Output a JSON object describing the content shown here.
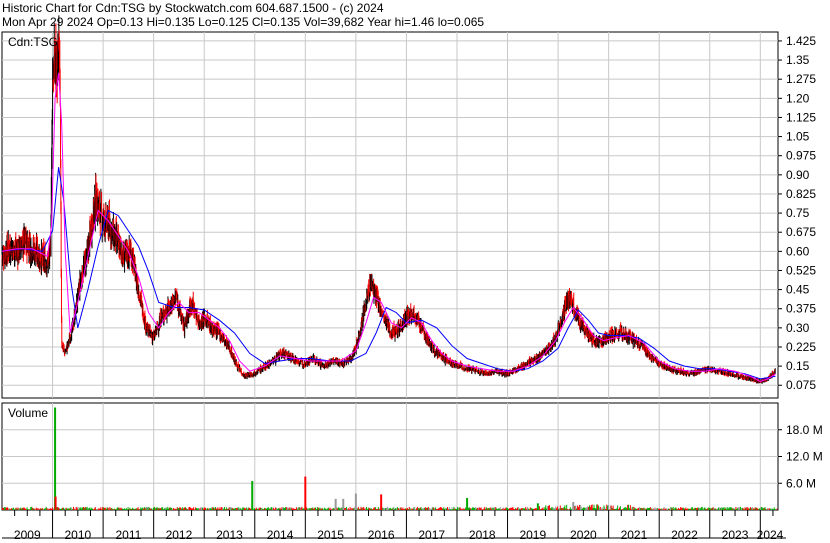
{
  "header": {
    "line1": "Historic Chart for Cdn:TSG by Stockwatch.com 604.687.1500 - (c) 2024",
    "line2": "Mon Apr 29 2024   Op=0.13   Hi=0.135   Lo=0.125   Cl=0.135   Vol=39,682   Year hi=1.46   lo=0.065"
  },
  "colors": {
    "candle_up": "#000000",
    "candle_down": "#ff0000",
    "ma_short": "#ff00ff",
    "ma_long": "#0000ff",
    "vol_up": "#00aa00",
    "vol_down": "#ff0000",
    "vol_neutral": "#999999",
    "grid": "#c8c8c8"
  },
  "chart_data": [
    {
      "type": "line",
      "panel": "price",
      "label": "Cdn:TSG",
      "y_ticks": [
        "1.425",
        "1.35",
        "1.275",
        "1.20",
        "1.125",
        "1.05",
        "0.975",
        "0.90",
        "0.825",
        "0.75",
        "0.675",
        "0.60",
        "0.525",
        "0.45",
        "0.375",
        "0.30",
        "0.225",
        "0.15",
        "0.075"
      ],
      "ylim": [
        0.025,
        1.46
      ],
      "x_labels": [
        "2009",
        "2010",
        "2011",
        "2012",
        "2013",
        "2014",
        "2015",
        "2016",
        "2017",
        "2018",
        "2019",
        "2020",
        "2021",
        "2022",
        "2023",
        "2024"
      ],
      "xlim": [
        2009.0,
        2024.35
      ],
      "grid": true,
      "series": [
        {
          "role": "price",
          "x": [
            2009.0,
            2009.15,
            2009.3,
            2009.45,
            2009.6,
            2009.75,
            2009.9,
            2009.96,
            2010.0,
            2010.05,
            2010.1,
            2010.14,
            2010.18,
            2010.24,
            2010.3,
            2010.4,
            2010.55,
            2010.7,
            2010.85,
            2011.0,
            2011.12,
            2011.25,
            2011.4,
            2011.55,
            2011.7,
            2011.85,
            2012.0,
            2012.15,
            2012.3,
            2012.45,
            2012.6,
            2012.75,
            2012.9,
            2013.0,
            2013.15,
            2013.3,
            2013.5,
            2013.65,
            2013.8,
            2013.95,
            2014.15,
            2014.35,
            2014.55,
            2014.75,
            2014.95,
            2015.15,
            2015.35,
            2015.55,
            2015.75,
            2015.9,
            2016.0,
            2016.1,
            2016.2,
            2016.3,
            2016.4,
            2016.55,
            2016.7,
            2016.85,
            2017.0,
            2017.15,
            2017.3,
            2017.45,
            2017.6,
            2017.75,
            2017.9,
            2018.05,
            2018.2,
            2018.4,
            2018.6,
            2018.8,
            2019.0,
            2019.2,
            2019.4,
            2019.6,
            2019.8,
            2019.95,
            2020.05,
            2020.15,
            2020.25,
            2020.35,
            2020.5,
            2020.65,
            2020.8,
            2020.95,
            2021.1,
            2021.3,
            2021.5,
            2021.7,
            2021.85,
            2022.0,
            2022.2,
            2022.4,
            2022.6,
            2022.8,
            2023.0,
            2023.2,
            2023.4,
            2023.6,
            2023.8,
            2024.0,
            2024.15,
            2024.3
          ],
          "values": [
            0.58,
            0.62,
            0.6,
            0.64,
            0.61,
            0.58,
            0.55,
            0.6,
            1.28,
            1.35,
            1.3,
            1.4,
            0.24,
            0.2,
            0.23,
            0.3,
            0.48,
            0.6,
            0.8,
            0.72,
            0.7,
            0.65,
            0.58,
            0.6,
            0.45,
            0.3,
            0.26,
            0.34,
            0.38,
            0.42,
            0.3,
            0.4,
            0.32,
            0.34,
            0.3,
            0.28,
            0.22,
            0.15,
            0.11,
            0.12,
            0.14,
            0.17,
            0.2,
            0.18,
            0.16,
            0.18,
            0.15,
            0.17,
            0.16,
            0.18,
            0.22,
            0.3,
            0.4,
            0.48,
            0.42,
            0.34,
            0.28,
            0.3,
            0.34,
            0.36,
            0.3,
            0.24,
            0.2,
            0.18,
            0.16,
            0.15,
            0.14,
            0.13,
            0.12,
            0.13,
            0.12,
            0.14,
            0.16,
            0.18,
            0.22,
            0.26,
            0.32,
            0.38,
            0.42,
            0.36,
            0.3,
            0.26,
            0.24,
            0.26,
            0.27,
            0.28,
            0.25,
            0.22,
            0.18,
            0.16,
            0.14,
            0.13,
            0.12,
            0.13,
            0.14,
            0.13,
            0.12,
            0.11,
            0.1,
            0.09,
            0.1,
            0.13
          ]
        },
        {
          "role": "moving-average-short",
          "x": [
            2009.0,
            2009.3,
            2009.6,
            2009.9,
            2009.98,
            2010.05,
            2010.12,
            2010.18,
            2010.25,
            2010.35,
            2010.5,
            2010.7,
            2010.9,
            2011.1,
            2011.3,
            2011.5,
            2011.7,
            2011.9,
            2012.1,
            2012.3,
            2012.5,
            2012.7,
            2012.9,
            2013.1,
            2013.3,
            2013.5,
            2013.7,
            2013.9,
            2014.2,
            2014.5,
            2014.8,
            2015.1,
            2015.4,
            2015.7,
            2016.0,
            2016.2,
            2016.35,
            2016.5,
            2016.7,
            2016.9,
            2017.1,
            2017.3,
            2017.5,
            2017.7,
            2017.9,
            2018.2,
            2018.5,
            2018.8,
            2019.1,
            2019.4,
            2019.7,
            2019.95,
            2020.15,
            2020.3,
            2020.5,
            2020.7,
            2020.9,
            2021.1,
            2021.4,
            2021.7,
            2022.0,
            2022.3,
            2022.6,
            2022.9,
            2023.2,
            2023.5,
            2023.8,
            2024.0,
            2024.15,
            2024.3
          ],
          "values": [
            0.6,
            0.61,
            0.61,
            0.58,
            0.7,
            1.2,
            1.3,
            1.1,
            0.6,
            0.28,
            0.4,
            0.58,
            0.76,
            0.72,
            0.66,
            0.6,
            0.5,
            0.36,
            0.3,
            0.36,
            0.4,
            0.36,
            0.36,
            0.33,
            0.3,
            0.25,
            0.17,
            0.13,
            0.15,
            0.19,
            0.18,
            0.17,
            0.17,
            0.17,
            0.21,
            0.32,
            0.42,
            0.4,
            0.32,
            0.3,
            0.34,
            0.32,
            0.25,
            0.2,
            0.17,
            0.15,
            0.14,
            0.13,
            0.13,
            0.15,
            0.19,
            0.25,
            0.33,
            0.38,
            0.33,
            0.27,
            0.25,
            0.26,
            0.27,
            0.24,
            0.17,
            0.14,
            0.13,
            0.13,
            0.14,
            0.13,
            0.11,
            0.09,
            0.1,
            0.12
          ]
        },
        {
          "role": "moving-average-long",
          "x": [
            2009.0,
            2009.4,
            2009.8,
            2010.0,
            2010.12,
            2010.22,
            2010.35,
            2010.5,
            2010.7,
            2010.9,
            2011.1,
            2011.3,
            2011.5,
            2011.7,
            2011.9,
            2012.1,
            2012.4,
            2012.7,
            2013.0,
            2013.3,
            2013.6,
            2013.9,
            2014.2,
            2014.5,
            2014.8,
            2015.1,
            2015.5,
            2015.9,
            2016.2,
            2016.4,
            2016.6,
            2016.8,
            2017.0,
            2017.3,
            2017.6,
            2017.9,
            2018.2,
            2018.5,
            2018.8,
            2019.1,
            2019.4,
            2019.7,
            2020.0,
            2020.2,
            2020.4,
            2020.6,
            2020.8,
            2021.0,
            2021.3,
            2021.6,
            2021.9,
            2022.2,
            2022.5,
            2022.8,
            2023.1,
            2023.4,
            2023.7,
            2024.0,
            2024.3
          ],
          "values": [
            0.6,
            0.61,
            0.6,
            0.68,
            0.93,
            0.8,
            0.5,
            0.3,
            0.45,
            0.62,
            0.76,
            0.74,
            0.68,
            0.62,
            0.52,
            0.4,
            0.38,
            0.38,
            0.37,
            0.33,
            0.28,
            0.2,
            0.16,
            0.17,
            0.18,
            0.18,
            0.17,
            0.17,
            0.2,
            0.28,
            0.38,
            0.36,
            0.32,
            0.33,
            0.3,
            0.23,
            0.18,
            0.16,
            0.14,
            0.13,
            0.14,
            0.17,
            0.22,
            0.3,
            0.37,
            0.33,
            0.28,
            0.27,
            0.27,
            0.26,
            0.22,
            0.17,
            0.15,
            0.14,
            0.14,
            0.13,
            0.12,
            0.1,
            0.11
          ]
        }
      ]
    },
    {
      "type": "bar",
      "panel": "volume",
      "label": "Volume",
      "y_ticks": [
        "18.0 M",
        "12.0 M",
        "6.0 M"
      ],
      "ylim": [
        0,
        24
      ],
      "spikes_x": [
        2010.05,
        2010.06,
        2013.95,
        2015.0,
        2015.6,
        2015.75,
        2016.0,
        2016.5,
        2018.2,
        2019.6,
        2020.3
      ],
      "spikes_values": [
        23.0,
        3.0,
        6.5,
        7.5,
        2.5,
        2.5,
        3.7,
        3.5,
        2.7,
        1.5,
        1.8
      ],
      "spikes_kind": [
        "up",
        "down",
        "up",
        "down",
        "neutral",
        "neutral",
        "neutral",
        "down",
        "up",
        "up",
        "neutral"
      ]
    }
  ]
}
